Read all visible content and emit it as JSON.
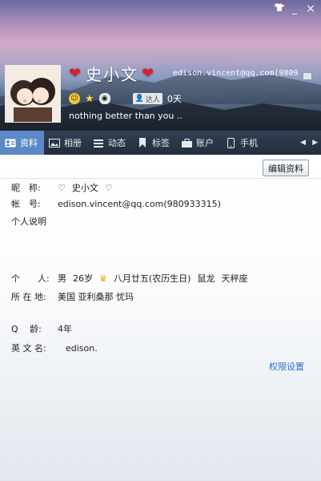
{
  "titlebar": {
    "skin_icon": "tshirt-icon",
    "minimize_label": "_",
    "close_label": "×"
  },
  "profile": {
    "name": "史小文",
    "email": "edison.vincent@qq.com(9809",
    "signature": "nothing better than you ..",
    "friend_tag": "达人",
    "days": "0天"
  },
  "tabs": [
    {
      "label": "资料",
      "icon": "id-card-icon"
    },
    {
      "label": "相册",
      "icon": "photo-icon"
    },
    {
      "label": "动态",
      "icon": "list-icon"
    },
    {
      "label": "标签",
      "icon": "bookmark-icon"
    },
    {
      "label": "账户",
      "icon": "briefcase-icon"
    },
    {
      "label": "手机",
      "icon": "phone-icon"
    }
  ],
  "actions": {
    "edit": "编辑资料",
    "permissions": "权限设置"
  },
  "info": {
    "nickname_label": "昵　称:",
    "nickname_value": "史小文",
    "account_label": "帐　号:",
    "account_value": "edison.vincent@qq.com(980933315)",
    "bio_label": "个人说明",
    "personal_label": "个　　人:",
    "gender": "男",
    "age": "26岁",
    "birthday": "八月廿五(农历生日)",
    "zodiac": "鼠龙",
    "constellation": "天秤座",
    "location_label": "所 在 地:",
    "location_value": "美国 亚利桑那 忧玛",
    "qage_label": "Q　  龄:",
    "qage_value": "4年",
    "english_label": "英 文 名:",
    "english_value": "edison."
  },
  "colors": {
    "accent": "#5b88c6",
    "link": "#2f6fd3",
    "heart": "#d9202e"
  }
}
